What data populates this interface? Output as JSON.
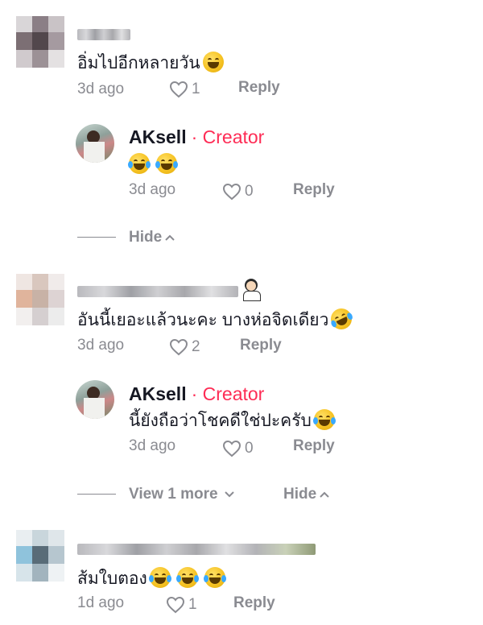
{
  "comments": [
    {
      "text": "อิ่มไปอีกหลายวัน",
      "time": "3d ago",
      "likes": "1",
      "reply_label": "Reply",
      "emoji": [
        "grin-sweat-emoji"
      ],
      "replies": [
        {
          "author": "AKsell",
          "badge": "· Creator",
          "text": "",
          "emoji": [
            "tears-of-joy-emoji",
            "tears-of-joy-emoji"
          ],
          "time": "3d ago",
          "likes": "0",
          "reply_label": "Reply"
        }
      ],
      "thread_controls": {
        "hide_label": "Hide"
      }
    },
    {
      "text": "อันนี้เยอะแล้วนะคะ บางห่อจิดเดียว",
      "time": "3d ago",
      "likes": "2",
      "reply_label": "Reply",
      "emoji": [
        "rofl-emoji"
      ],
      "replies": [
        {
          "author": "AKsell",
          "badge": "· Creator",
          "text": "นี้ยังถือว่าโชคดีใช่ปะครับ",
          "emoji": [
            "tears-of-joy-emoji"
          ],
          "time": "3d ago",
          "likes": "0",
          "reply_label": "Reply"
        }
      ],
      "thread_controls": {
        "view_more_label": "View 1 more",
        "hide_label": "Hide"
      }
    },
    {
      "text": "ส้มใบตอง",
      "time": "1d ago",
      "likes": "1",
      "reply_label": "Reply",
      "emoji": [
        "tears-of-joy-emoji",
        "tears-of-joy-emoji",
        "tears-of-joy-emoji"
      ]
    }
  ],
  "colors": {
    "creator_accent": "#fe2c55",
    "meta_gray": "#8a8b91",
    "text": "#161823"
  }
}
